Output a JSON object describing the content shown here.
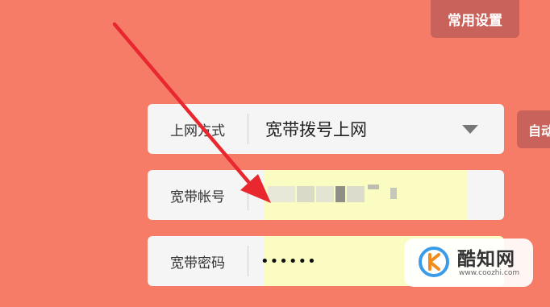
{
  "header": {
    "settings_button": "常用设置"
  },
  "form": {
    "connection": {
      "label": "上网方式",
      "value": "宽带拨号上网",
      "icon": "chevron-down-icon"
    },
    "account": {
      "label": "宽带帐号",
      "value": "",
      "note_colors": {
        "field_bg": "#fafcc2"
      }
    },
    "password": {
      "label": "宽带密码",
      "value": "••••••"
    },
    "side_button": "自动"
  },
  "overlay": {
    "annotation_arrow_color": "#e8272e",
    "icon": "red-annotation-arrow-icon"
  },
  "watermark": {
    "name": "酷知网",
    "url": "www.coozhi.com",
    "icon": "coozhi-logo-icon"
  },
  "theme": {
    "background": "#f67c68",
    "button_bg": "#c9625a",
    "row_bg": "#f5f5f5"
  }
}
